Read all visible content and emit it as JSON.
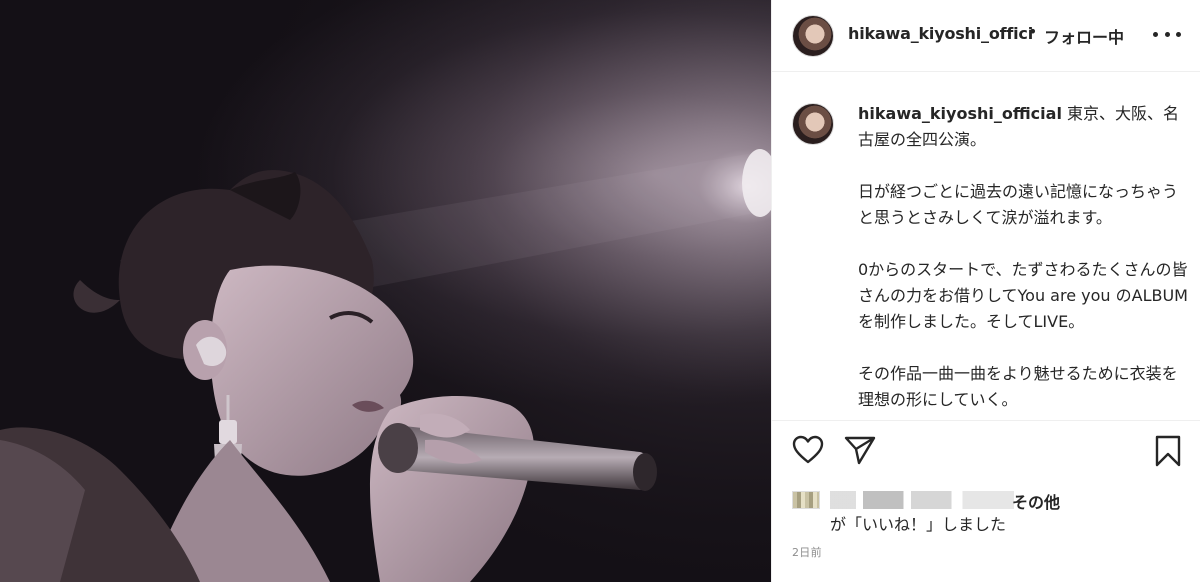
{
  "post": {
    "username": "hikawa_kiyoshi_official",
    "username_truncated": "hikawa_kiyoshi_offici",
    "separator": "•",
    "follow_status": "フォロー中",
    "caption_user": "hikawa_kiyoshi_official",
    "caption_text": " 東京、大阪、名古屋の全四公演。\n\n日が経つごとに過去の遠い記憶になっちゃうと思うとさみしくて涙が溢れます。\n\n0からのスタートで、たずさわるたくさんの皆さんの力をお借りしてYou are you のALBUMを制作しました。そしてLIVE。\n\nその作品一曲一曲をより魅せるために衣装を理想の形にしていく。",
    "likes_others": "その他",
    "likes_suffix": "が「いいね！」しました",
    "timestamp": "2日前"
  },
  "icons": {
    "more": "more-horizontal-icon",
    "like": "heart-icon",
    "share": "paper-plane-icon",
    "save": "bookmark-icon"
  },
  "colors": {
    "text": "#262626",
    "secondary": "#8e8e8e",
    "divider": "#efefef"
  }
}
